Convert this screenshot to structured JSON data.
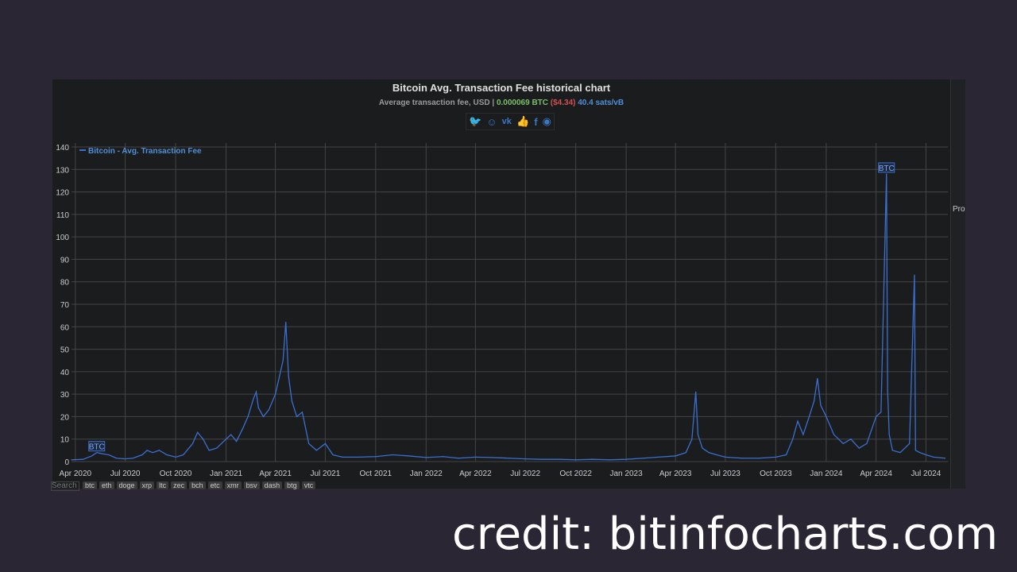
{
  "header": {
    "title": "Bitcoin Avg. Transaction Fee historical chart",
    "subtitle_prefix": "Average transaction fee, USD |",
    "btc_value": "0.000069 BTC",
    "usd_value": "($4.34)",
    "sats_value": "40.4 sats/vB"
  },
  "share_icons": [
    "twitter-icon",
    "reddit-icon",
    "vk-icon",
    "like-icon",
    "facebook-icon",
    "weibo-icon"
  ],
  "side": {
    "tab_label": "Pro"
  },
  "search": {
    "placeholder": "Search"
  },
  "coins": [
    "btc",
    "eth",
    "doge",
    "xrp",
    "ltc",
    "zec",
    "bch",
    "etc",
    "xmr",
    "bsv",
    "dash",
    "btg",
    "vtc"
  ],
  "credit": "credit: bitinfocharts.com",
  "colors": {
    "line": "#3a6fd0",
    "background": "#1b1c1e",
    "grid": "#444444"
  },
  "chart_data": {
    "type": "line",
    "title": "Bitcoin Avg. Transaction Fee historical chart",
    "legend": "Bitcoin - Avg. Transaction Fee",
    "legend_placement": "top-left",
    "ylim": [
      0,
      140
    ],
    "yticks": [
      0,
      10,
      20,
      30,
      40,
      50,
      60,
      70,
      80,
      90,
      100,
      110,
      120,
      130,
      140
    ],
    "xlim": [
      "2020-03-25",
      "2024-08-10"
    ],
    "xticks": [
      [
        "2020-04-01",
        "Apr 2020"
      ],
      [
        "2020-07-01",
        "Jul 2020"
      ],
      [
        "2020-10-01",
        "Oct 2020"
      ],
      [
        "2021-01-01",
        "Jan 2021"
      ],
      [
        "2021-04-01",
        "Apr 2021"
      ],
      [
        "2021-07-01",
        "Jul 2021"
      ],
      [
        "2021-10-01",
        "Oct 2021"
      ],
      [
        "2022-01-01",
        "Jan 2022"
      ],
      [
        "2022-04-01",
        "Apr 2022"
      ],
      [
        "2022-07-01",
        "Jul 2022"
      ],
      [
        "2022-10-01",
        "Oct 2022"
      ],
      [
        "2023-01-01",
        "Jan 2023"
      ],
      [
        "2023-04-01",
        "Apr 2023"
      ],
      [
        "2023-07-01",
        "Jul 2023"
      ],
      [
        "2023-10-01",
        "Oct 2023"
      ],
      [
        "2024-01-01",
        "Jan 2024"
      ],
      [
        "2024-04-01",
        "Apr 2024"
      ],
      [
        "2024-07-01",
        "Jul 2024"
      ]
    ],
    "grid": true,
    "annotations": [
      {
        "date": "2020-05-10",
        "value": 4,
        "text": "BTC"
      },
      {
        "date": "2024-04-20",
        "value": 128,
        "text": "BTC"
      }
    ],
    "points": [
      [
        "2020-03-25",
        0.8
      ],
      [
        "2020-04-15",
        1.0
      ],
      [
        "2020-05-01",
        2.5
      ],
      [
        "2020-05-10",
        4
      ],
      [
        "2020-05-20",
        3.5
      ],
      [
        "2020-06-01",
        3
      ],
      [
        "2020-06-15",
        1.5
      ],
      [
        "2020-07-01",
        1.2
      ],
      [
        "2020-07-15",
        1.5
      ],
      [
        "2020-08-01",
        3
      ],
      [
        "2020-08-10",
        5
      ],
      [
        "2020-08-20",
        4
      ],
      [
        "2020-09-01",
        5
      ],
      [
        "2020-09-15",
        3
      ],
      [
        "2020-10-01",
        2
      ],
      [
        "2020-10-15",
        3
      ],
      [
        "2020-11-01",
        8
      ],
      [
        "2020-11-10",
        13
      ],
      [
        "2020-11-20",
        10
      ],
      [
        "2020-12-01",
        5
      ],
      [
        "2020-12-15",
        6
      ],
      [
        "2021-01-01",
        10
      ],
      [
        "2021-01-10",
        12
      ],
      [
        "2021-01-20",
        9
      ],
      [
        "2021-02-01",
        15
      ],
      [
        "2021-02-10",
        20
      ],
      [
        "2021-02-20",
        28
      ],
      [
        "2021-02-25",
        31
      ],
      [
        "2021-03-01",
        24
      ],
      [
        "2021-03-10",
        20
      ],
      [
        "2021-03-20",
        23
      ],
      [
        "2021-04-01",
        30
      ],
      [
        "2021-04-15",
        45
      ],
      [
        "2021-04-20",
        62
      ],
      [
        "2021-04-25",
        38
      ],
      [
        "2021-05-01",
        27
      ],
      [
        "2021-05-10",
        20
      ],
      [
        "2021-05-20",
        22
      ],
      [
        "2021-06-01",
        8
      ],
      [
        "2021-06-15",
        5
      ],
      [
        "2021-07-01",
        8
      ],
      [
        "2021-07-15",
        3
      ],
      [
        "2021-08-01",
        2
      ],
      [
        "2021-09-01",
        2
      ],
      [
        "2021-10-01",
        2.2
      ],
      [
        "2021-11-01",
        3
      ],
      [
        "2021-12-01",
        2.5
      ],
      [
        "2022-01-01",
        1.8
      ],
      [
        "2022-02-01",
        2.2
      ],
      [
        "2022-03-01",
        1.5
      ],
      [
        "2022-04-01",
        2
      ],
      [
        "2022-05-01",
        1.8
      ],
      [
        "2022-06-01",
        1.5
      ],
      [
        "2022-07-01",
        1.2
      ],
      [
        "2022-08-01",
        1
      ],
      [
        "2022-09-01",
        1
      ],
      [
        "2022-10-01",
        0.8
      ],
      [
        "2022-11-01",
        1
      ],
      [
        "2022-12-01",
        0.8
      ],
      [
        "2023-01-01",
        1
      ],
      [
        "2023-02-01",
        1.5
      ],
      [
        "2023-03-01",
        2
      ],
      [
        "2023-04-01",
        2.5
      ],
      [
        "2023-04-20",
        4
      ],
      [
        "2023-05-01",
        10
      ],
      [
        "2023-05-08",
        31
      ],
      [
        "2023-05-12",
        12
      ],
      [
        "2023-05-20",
        6
      ],
      [
        "2023-06-01",
        4
      ],
      [
        "2023-06-15",
        3
      ],
      [
        "2023-07-01",
        2
      ],
      [
        "2023-08-01",
        1.5
      ],
      [
        "2023-09-01",
        1.5
      ],
      [
        "2023-10-01",
        2
      ],
      [
        "2023-10-20",
        3
      ],
      [
        "2023-11-01",
        10
      ],
      [
        "2023-11-10",
        18
      ],
      [
        "2023-11-20",
        12
      ],
      [
        "2023-12-01",
        20
      ],
      [
        "2023-12-10",
        27
      ],
      [
        "2023-12-16",
        37
      ],
      [
        "2023-12-22",
        25
      ],
      [
        "2024-01-01",
        20
      ],
      [
        "2024-01-15",
        12
      ],
      [
        "2024-02-01",
        8
      ],
      [
        "2024-02-15",
        10
      ],
      [
        "2024-03-01",
        6
      ],
      [
        "2024-03-15",
        8
      ],
      [
        "2024-04-01",
        20
      ],
      [
        "2024-04-10",
        22
      ],
      [
        "2024-04-20",
        128
      ],
      [
        "2024-04-22",
        32
      ],
      [
        "2024-04-25",
        12
      ],
      [
        "2024-05-01",
        5
      ],
      [
        "2024-05-15",
        4
      ],
      [
        "2024-06-01",
        8
      ],
      [
        "2024-06-10",
        83
      ],
      [
        "2024-06-12",
        5
      ],
      [
        "2024-06-20",
        4
      ],
      [
        "2024-07-01",
        3
      ],
      [
        "2024-07-15",
        2
      ],
      [
        "2024-08-05",
        1.5
      ]
    ]
  }
}
